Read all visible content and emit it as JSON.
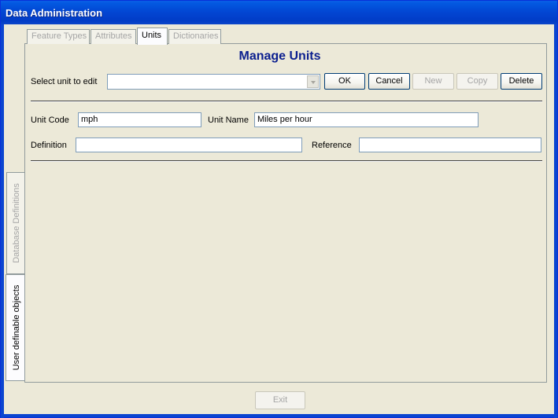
{
  "window": {
    "title": "Data Administration"
  },
  "side_tabs": [
    {
      "label": "Database Definitions",
      "active": false
    },
    {
      "label": "User definable objects",
      "active": true
    }
  ],
  "tabs": [
    {
      "label": "Feature Types",
      "active": false
    },
    {
      "label": "Attributes",
      "active": false
    },
    {
      "label": "Units",
      "active": true
    },
    {
      "label": "Dictionaries",
      "active": false
    }
  ],
  "heading": "Manage Units",
  "select_unit": {
    "label": "Select unit to edit",
    "value": ""
  },
  "buttons": {
    "ok": "OK",
    "cancel": "Cancel",
    "new": "New",
    "copy": "Copy",
    "delete": "Delete",
    "exit": "Exit"
  },
  "fields": {
    "unit_code": {
      "label": "Unit Code",
      "value": "mph"
    },
    "unit_name": {
      "label": "Unit Name",
      "value": "Miles per hour"
    },
    "definition": {
      "label": "Definition",
      "value": ""
    },
    "reference": {
      "label": "Reference",
      "value": ""
    }
  },
  "colors": {
    "title_bar": "#0245d2",
    "heading": "#0b1f8f",
    "disabled_text": "#a5a5a5"
  }
}
